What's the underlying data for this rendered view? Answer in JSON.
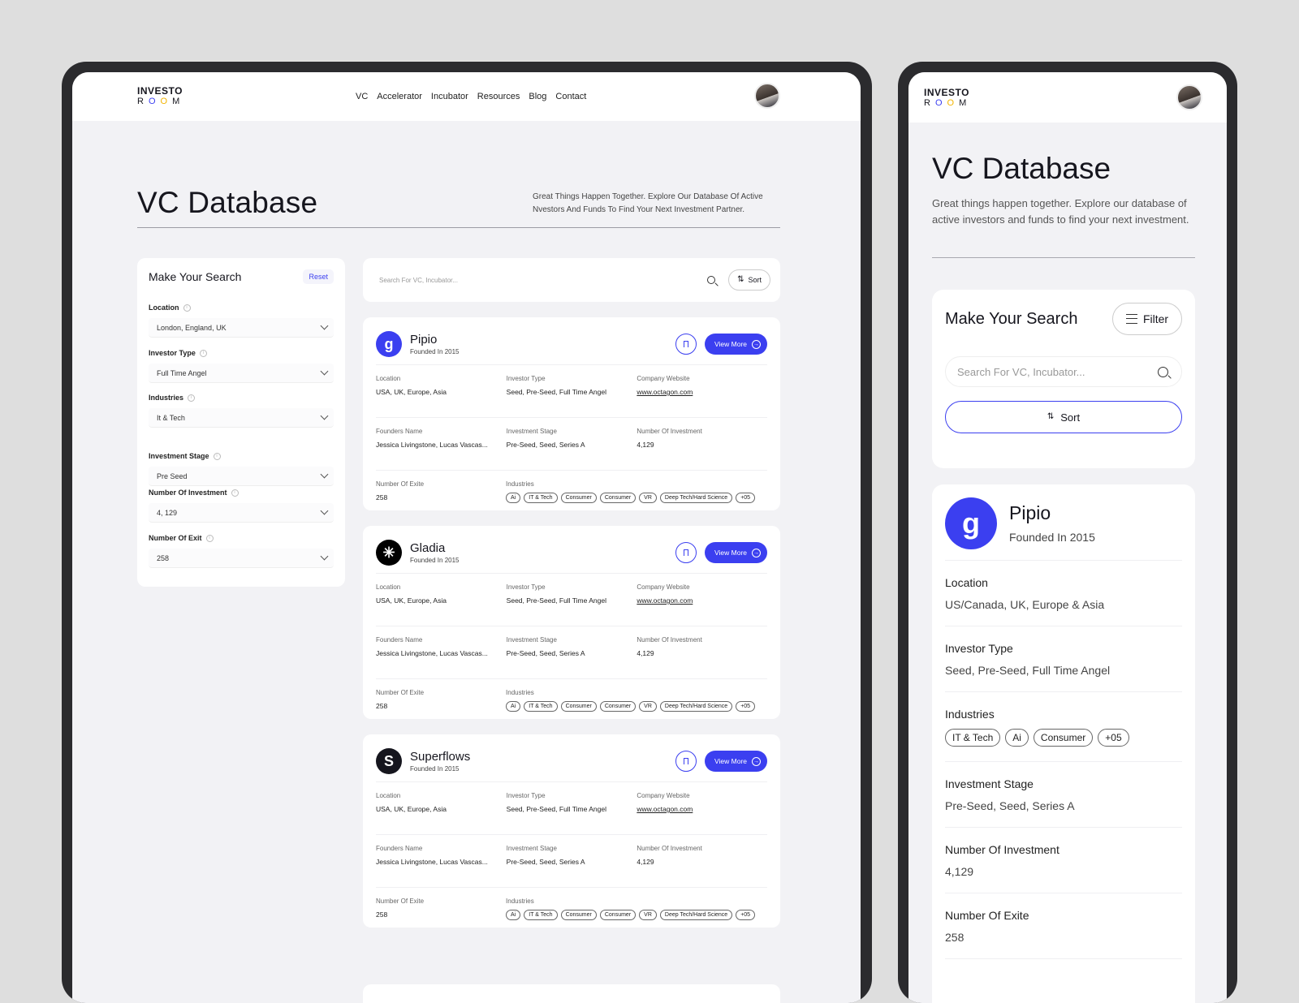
{
  "brand": {
    "line1": "INVESTO",
    "line2": [
      "R",
      "O",
      "O",
      "M"
    ]
  },
  "nav": {
    "items": [
      "VC",
      "Accelerator",
      "Incubator",
      "Resources",
      "Blog",
      "Contact"
    ]
  },
  "hero": {
    "title": "VC Database",
    "desktop_desc": "Great Things Happen Together. Explore Our Database Of Active Nvestors And Funds To Find Your Next Investment Partner.",
    "mobile_desc": "Great things happen together. Explore our database of active investors and funds to find your next investment."
  },
  "filters": {
    "title": "Make Your Search",
    "reset": "Reset",
    "location": {
      "label": "Location",
      "value": "London, England, UK"
    },
    "investor_type": {
      "label": "Investor Type",
      "value": "Full Time Angel"
    },
    "industries": {
      "label": "Industries",
      "value": "It & Tech"
    },
    "investment_stage": {
      "label": "Investment Stage",
      "value": "Pre Seed"
    },
    "number_of_investment": {
      "label": "Number Of Investment",
      "value": "4, 129"
    },
    "number_of_exit": {
      "label": "Number Of Exit",
      "value": "258"
    }
  },
  "search": {
    "placeholder": "Search For VC, Incubator...",
    "sort": "Sort",
    "filter": "Filter"
  },
  "labels": {
    "location": "Location",
    "investor_type": "Investor Type",
    "company_website": "Company Website",
    "founders_name": "Founders Name",
    "investment_stage": "Investment Stage",
    "number_of_investment": "Number Of Investment",
    "number_of_exite": "Number Of Exite",
    "industries": "Industries",
    "view_more": "View More"
  },
  "vcs": [
    {
      "name": "Pipio",
      "founded": "Founded In 2015",
      "logo_glyph": "g",
      "location": "USA, UK, Europe, Asia",
      "investor_type": "Seed, Pre-Seed, Full Time Angel",
      "website": "www.octagon.com",
      "founders": "Jessica Livingstone, Lucas Vascas...",
      "stage": "Pre-Seed, Seed, Series A",
      "investments": "4,129",
      "exits": "258",
      "tags": [
        "Ai",
        "IT & Tech",
        "Consumer",
        "Consumer",
        "VR",
        "Deep Tech/Hard Science",
        "+05"
      ]
    },
    {
      "name": "Gladia",
      "founded": "Founded In 2015",
      "logo_glyph": "✳",
      "location": "USA, UK, Europe, Asia",
      "investor_type": "Seed, Pre-Seed, Full Time Angel",
      "website": "www.octagon.com",
      "founders": "Jessica Livingstone, Lucas Vascas...",
      "stage": "Pre-Seed, Seed, Series A",
      "investments": "4,129",
      "exits": "258",
      "tags": [
        "Ai",
        "IT & Tech",
        "Consumer",
        "Consumer",
        "VR",
        "Deep Tech/Hard Science",
        "+05"
      ]
    },
    {
      "name": "Superflows",
      "founded": "Founded In 2015",
      "logo_glyph": "S",
      "location": "USA, UK, Europe, Asia",
      "investor_type": "Seed, Pre-Seed, Full Time Angel",
      "website": "www.octagon.com",
      "founders": "Jessica Livingstone, Lucas Vascas...",
      "stage": "Pre-Seed, Seed, Series A",
      "investments": "4,129",
      "exits": "258",
      "tags": [
        "Ai",
        "IT & Tech",
        "Consumer",
        "Consumer",
        "VR",
        "Deep Tech/Hard Science",
        "+05"
      ]
    }
  ],
  "mobile_card": {
    "name": "Pipio",
    "founded": "Founded In 2015",
    "logo_glyph": "g",
    "location": "US/Canada, UK, Europe & Asia",
    "investor_type": "Seed, Pre-Seed, Full Time Angel",
    "industries_tags": [
      "IT & Tech",
      "Ai",
      "Consumer",
      "+05"
    ],
    "stage": "Pre-Seed, Seed, Series A",
    "investments": "4,129",
    "exits": "258"
  },
  "colors": {
    "accent": "#3b3ff0",
    "yellow": "#f2b400",
    "bg": "#f2f2f5"
  },
  "icons": {
    "bookmark": "bookmark-icon",
    "search": "search-icon",
    "sort": "sort-icon",
    "filter": "filter-icon",
    "info": "info-icon",
    "chevron": "chevron-down-icon",
    "arrow": "arrow-right-icon"
  }
}
